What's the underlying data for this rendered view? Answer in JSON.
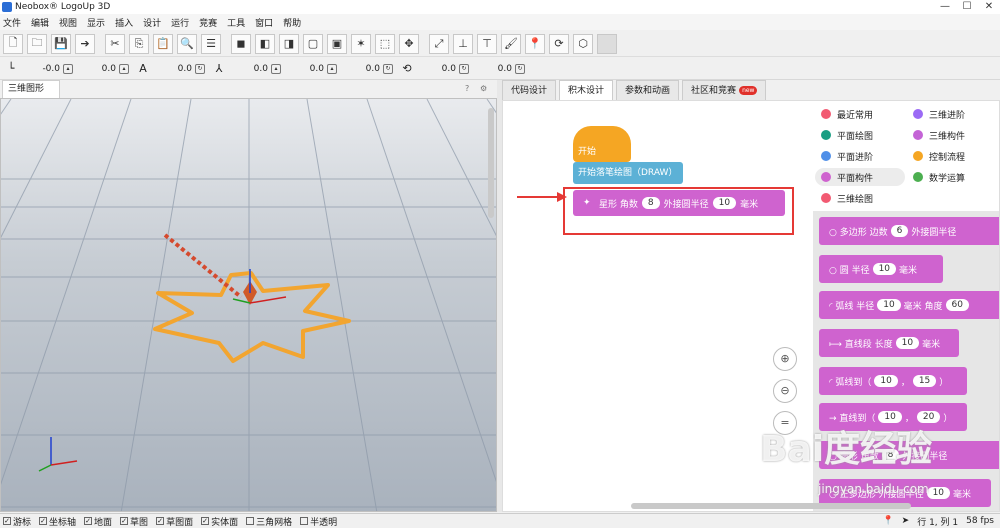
{
  "window": {
    "title": "Neobox® LogoUp 3D",
    "min": "—",
    "max": "☐",
    "close": "✕"
  },
  "menu": [
    "文件",
    "编辑",
    "视图",
    "显示",
    "插入",
    "设计",
    "运行",
    "竞赛",
    "工具",
    "窗口",
    "帮助"
  ],
  "toolbar": {
    "icons": [
      "new-file-icon",
      "open-folder-icon",
      "save-icon",
      "import-icon",
      "cut-icon",
      "copy-icon",
      "paste-icon",
      "search-icon",
      "indent-icon",
      "cube-icon",
      "cube-icon",
      "cube-icon",
      "cube-outline-icon",
      "cube-outline-icon",
      "star-shape-icon",
      "frame-icon",
      "move-icon",
      "expand-icon",
      "axis-icon",
      "axis-icon",
      "paint-icon",
      "pin-icon",
      "rotate-box-icon",
      "box-icon",
      "blank-icon"
    ]
  },
  "coords": {
    "f1": "-0.0",
    "f2": "0.0",
    "f3": "0.0",
    "f4": "0.0",
    "f5": "0.0",
    "f6": "0.0",
    "f7": "0.0",
    "f8": "0.0"
  },
  "viewport": {
    "tab": "三维图形",
    "help": "?",
    "menu": "⚙"
  },
  "tabs": [
    {
      "label": "代码设计",
      "active": false
    },
    {
      "label": "积木设计",
      "active": true
    },
    {
      "label": "参数和动画",
      "active": false
    },
    {
      "label": "社区和竞赛",
      "active": false,
      "badge": "new"
    }
  ],
  "workspace": {
    "hat": "开始",
    "draw": "开始落笔绘图（DRAW）",
    "star": {
      "label1": "星形 角数",
      "v1": "8",
      "label2": "外接圆半径",
      "v2": "10",
      "unit": "毫米"
    },
    "zoom_in": "⊕",
    "zoom_out": "⊖",
    "reset": "="
  },
  "categories": [
    {
      "label": "最近常用",
      "color": "#f25a72"
    },
    {
      "label": "平面绘图",
      "color": "#1a9e83"
    },
    {
      "label": "平面进阶",
      "color": "#4f8fe8"
    },
    {
      "label": "平面构件",
      "color": "#cf63cf",
      "active": true
    },
    {
      "label": "三维绘图",
      "color": "#f25a72"
    },
    {
      "label": "三维进阶",
      "color": "#9b6af5"
    },
    {
      "label": "三维构件",
      "color": "#c464d6"
    },
    {
      "label": "控制流程",
      "color": "#f5a623"
    },
    {
      "label": "数学运算",
      "color": "#4caf50"
    }
  ],
  "flyout": {
    "b1": {
      "t1": "○ 多边形 边数",
      "v1": "6",
      "t2": "外接圆半径"
    },
    "b2": {
      "t1": "○ 圆 半径",
      "v1": "10",
      "t2": "毫米"
    },
    "b3": {
      "t1": "◜ 弧线 半径",
      "v1": "10",
      "t2": "毫米 角度",
      "v2": "60"
    },
    "b4": {
      "t1": "⟼ 直线段 长度",
      "v1": "10",
      "t2": "毫米"
    },
    "b5": {
      "t1": "◜ 弧线到（",
      "v1": "10",
      "t2": "，",
      "v2": "15",
      "t3": "）"
    },
    "b6": {
      "t1": "→ 直线到（",
      "v1": "10",
      "t2": "，",
      "v2": "20",
      "t3": "）"
    },
    "b7": {
      "t1": "○ 扇形 角数",
      "v1": "8",
      "t2": "外接圆半径"
    },
    "b8": {
      "t1": "○ 正多边形 外接圆半径",
      "v1": "10",
      "t2": "毫米"
    }
  },
  "watermark": {
    "logo": "Bai度经验",
    "url": "jingyan.baidu.com"
  },
  "status": {
    "checks": [
      {
        "label": "游标",
        "checked": true
      },
      {
        "label": "坐标轴",
        "checked": true
      },
      {
        "label": "地面",
        "checked": true
      },
      {
        "label": "草图",
        "checked": true
      },
      {
        "label": "草图面",
        "checked": true
      },
      {
        "label": "实体面",
        "checked": true
      },
      {
        "label": "三角网格",
        "checked": false
      },
      {
        "label": "半透明",
        "checked": false
      }
    ],
    "position": "行 1, 列 1",
    "fps": "58 fps"
  }
}
